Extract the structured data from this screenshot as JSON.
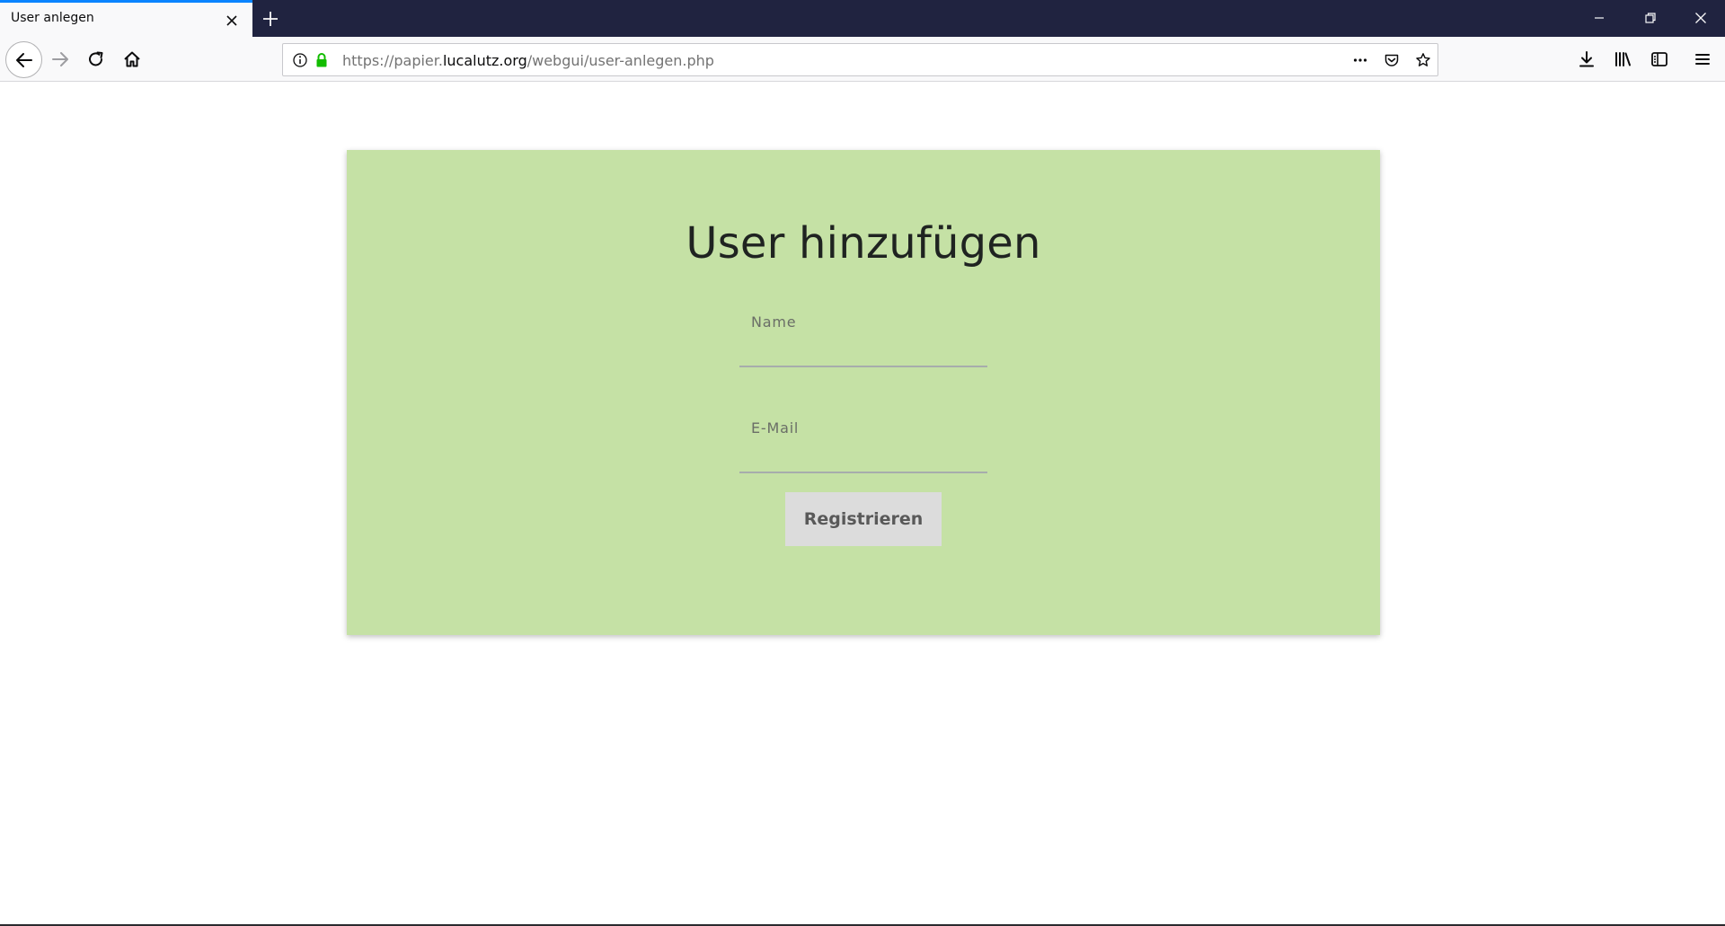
{
  "browser": {
    "tab_title": "User anlegen",
    "url_prefix": "https://papier.",
    "url_host": "lucalutz.org",
    "url_path": "/webgui/user-anlegen.php",
    "accent_color": "#0a84ff",
    "lock_color": "#12bc00"
  },
  "form": {
    "title": "User hinzufügen",
    "name_label": "Name",
    "email_label": "E-Mail",
    "submit_label": "Registrieren",
    "card_color": "#c5e1a5"
  }
}
